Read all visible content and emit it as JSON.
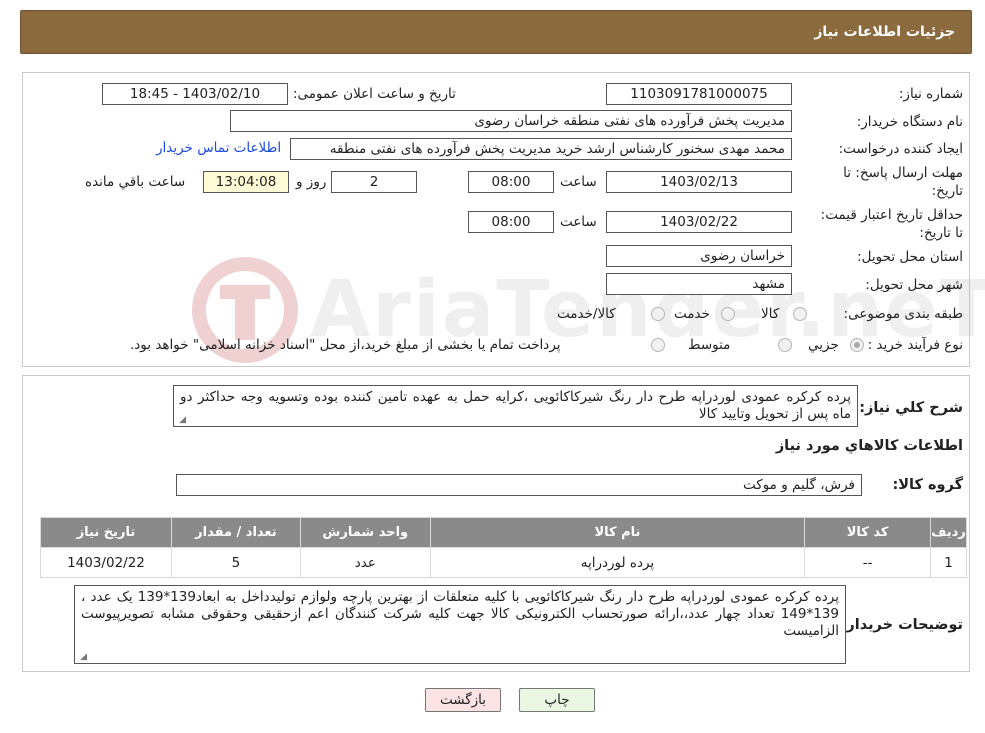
{
  "header": {
    "title": "جزئیات اطلاعات نیاز"
  },
  "labels": {
    "need_number": "شماره نیاز:",
    "announce_datetime": "تاریخ و ساعت اعلان عمومی:",
    "buyer_org": "نام دستگاه خریدار:",
    "requester": "ایجاد کننده درخواست:",
    "buyer_contact_link": "اطلاعات تماس خریدار",
    "reply_deadline": "مهلت ارسال پاسخ: تا تاریخ:",
    "hour": "ساعت",
    "day_and": "روز و",
    "remaining_hours": "ساعت باقي مانده",
    "price_validity": "حداقل تاریخ اعتبار قیمت: تا تاریخ:",
    "delivery_province": "استان محل تحویل:",
    "delivery_city": "شهر محل تحویل:",
    "category": "طبقه بندی موضوعی:",
    "purchase_type": "نوع فرآیند خرید :",
    "general_desc": "شرح کلي نياز:",
    "items_section": "اطلاعات کالاهاي مورد نياز",
    "goods_group": "گروه کالا:",
    "buyer_notes": "توضیحات خریدار:"
  },
  "values": {
    "need_number": "1103091781000075",
    "announce_datetime": "1403/02/10 - 18:45",
    "buyer_org": "مدیریت پخش فرآورده های نفتی منطقه خراسان رضوی",
    "requester": "محمد مهدی سخنور کارشناس ارشد خرید مدیریت پخش فرآورده های نفتی منطقه",
    "reply_date": "1403/02/13",
    "reply_time": "08:00",
    "days_left": "2",
    "time_left": "13:04:08",
    "validity_date": "1403/02/22",
    "validity_time": "08:00",
    "province": "خراسان رضوی",
    "city": "مشهد",
    "general_desc": "پرده کرکره عمودی لوردراپه طرح دار رنگ شیرکاکائویی ،کرایه حمل به عهده تامین کننده بوده وتسویه وجه حداکثر دو ماه پس از تحویل وتایید کالا",
    "goods_group": "فرش، گلیم و موکت",
    "buyer_notes": "پرده کرکره عمودی لوردراپه طرح دار رنگ شیرکاکائویی با کلیه متعلقات از بهترین پارچه ولوازم تولیدداخل به ابعاد139*139 یک عدد ، 139*149 تعداد چهار عدد،،ارائه صورتحساب الکترونیکی کالا جهت کلیه شرکت کنندگان اعم ازحقیقی وحقوقی مشابه تصویرپیوست الزامیست"
  },
  "category_options": {
    "goods": "کالا",
    "service": "خدمت",
    "goods_service": "کالا/خدمت"
  },
  "purchase_options": {
    "partial": "جزيي",
    "medium": "متوسط",
    "note": "پرداخت تمام یا بخشی از مبلغ خرید،از محل \"اسناد خزانه اسلامی\" خواهد بود."
  },
  "table": {
    "headers": [
      "ردیف",
      "کد کالا",
      "نام کالا",
      "واحد شمارش",
      "تعداد / مقدار",
      "تاریخ نیاز"
    ],
    "rows": [
      [
        "1",
        "--",
        "پرده لوردراپه",
        "عدد",
        "5",
        "1403/02/22"
      ]
    ]
  },
  "buttons": {
    "print": "چاپ",
    "back": "بازگشت"
  },
  "watermark": "AriaTender.neT",
  "colors": {
    "header_bg": "#8b6a3e",
    "table_header_bg": "#8a8a8a",
    "back_btn_bg": "#fde3e3",
    "print_btn_bg": "#eaf8e3",
    "link": "#1a4ae0"
  }
}
